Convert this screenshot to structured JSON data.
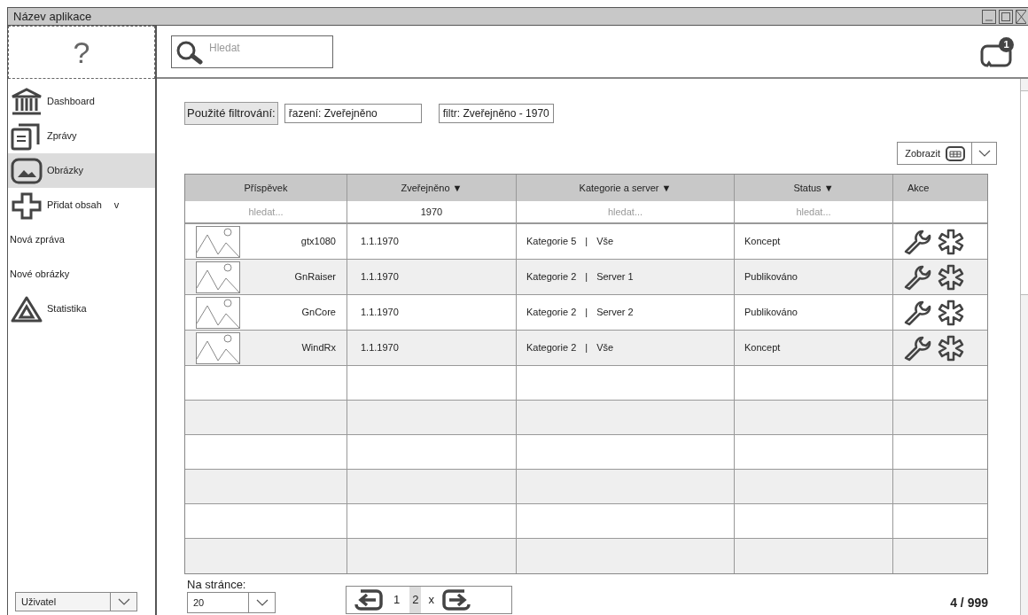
{
  "window": {
    "title": "Název aplikace"
  },
  "help": "?",
  "search": {
    "placeholder": "Hledat"
  },
  "notifications": {
    "badge": "1"
  },
  "sidebar": {
    "items": [
      {
        "kind": "icon",
        "label": "Dashboard",
        "selected": false
      },
      {
        "kind": "icon",
        "label": "Zprávy",
        "selected": false
      },
      {
        "kind": "icon",
        "label": "Obrázky",
        "selected": true
      },
      {
        "kind": "icon",
        "label": "Přidat obsah",
        "marker": "v",
        "selected": false
      },
      {
        "kind": "plain",
        "label": "Nová zpráva",
        "selected": false
      },
      {
        "kind": "plain",
        "label": "Nové obrázky",
        "selected": false
      },
      {
        "kind": "icon",
        "label": "Statistika",
        "selected": false
      }
    ],
    "user_select": "Uživatel"
  },
  "filters": {
    "label": "Použité filtrování:",
    "chips": [
      "řazení: Zveřejněno",
      "filtr: Zveřejněno - 1970"
    ]
  },
  "view_button": "Zobrazit",
  "table": {
    "columns": [
      "Příspěvek",
      "Zveřejněno ▼",
      "Kategorie a server ▼",
      "Status ▼",
      "Akce"
    ],
    "filter_row": [
      {
        "kind": "placeholder",
        "text": "hledat..."
      },
      {
        "kind": "value",
        "text": "1970"
      },
      {
        "kind": "placeholder",
        "text": "hledat..."
      },
      {
        "kind": "placeholder",
        "text": "hledat..."
      }
    ],
    "rows": [
      {
        "name": "gtx1080",
        "date": "1.1.1970",
        "category": "Kategorie 5",
        "server": "Vše",
        "status": "Koncept"
      },
      {
        "name": "GnRaiser",
        "date": "1.1.1970",
        "category": "Kategorie 2",
        "server": "Server 1",
        "status": "Publikováno"
      },
      {
        "name": "GnCore",
        "date": "1.1.1970",
        "category": "Kategorie 2",
        "server": "Server 2",
        "status": "Publikováno"
      },
      {
        "name": "WindRx",
        "date": "1.1.1970",
        "category": "Kategorie 2",
        "server": "Vše",
        "status": "Koncept"
      }
    ],
    "separator": "|"
  },
  "per_page": {
    "label": "Na stránce:",
    "value": "20"
  },
  "pagination": {
    "pages": [
      {
        "label": "1",
        "selected": false
      },
      {
        "label": "2",
        "selected": true
      }
    ],
    "close": "x"
  },
  "count": "4 / 999"
}
